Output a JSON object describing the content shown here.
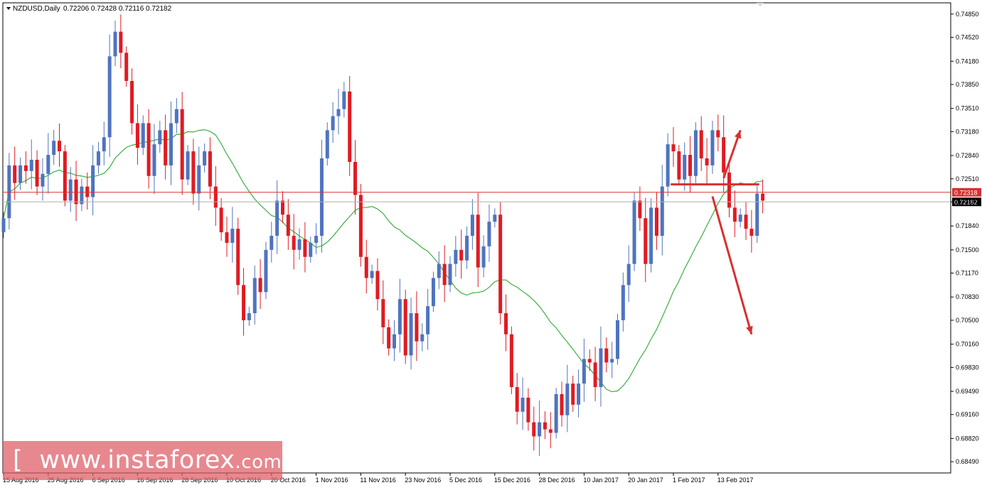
{
  "header": {
    "symbol": "NZDUSD,Daily",
    "ohlc": "0.72206 0.72428 0.72116 0.72182"
  },
  "watermark": {
    "open": "[",
    "site": "www.instaforex",
    "tld": ".com",
    "close": "]"
  },
  "colors": {
    "bull": "#4f74bf",
    "bear": "#e01b22",
    "ma": "#3cb043",
    "level": "#d83030",
    "background": "#ffffff"
  },
  "chart_data": {
    "type": "candlestick",
    "symbol": "NZDUSD",
    "timeframe": "Daily",
    "ylim": [
      0.6833,
      0.7501
    ],
    "y_ticks": [
      "0.74850",
      "0.74520",
      "0.74180",
      "0.73850",
      "0.73510",
      "0.73180",
      "0.72840",
      "0.72510",
      "0.72182",
      "0.71840",
      "0.71500",
      "0.71170",
      "0.70830",
      "0.70500",
      "0.70160",
      "0.69830",
      "0.69490",
      "0.69160",
      "0.68820",
      "0.68490"
    ],
    "x_labels": [
      {
        "text": "15 Aug 2016",
        "index": 0
      },
      {
        "text": "25 Aug 2016",
        "index": 8
      },
      {
        "text": "6 Sep 2016",
        "index": 16
      },
      {
        "text": "16 Sep 2016",
        "index": 24
      },
      {
        "text": "28 Sep 2016",
        "index": 32
      },
      {
        "text": "10 Oct 2016",
        "index": 40
      },
      {
        "text": "20 Oct 2016",
        "index": 48
      },
      {
        "text": "1 Nov 2016",
        "index": 56
      },
      {
        "text": "11 Nov 2016",
        "index": 64
      },
      {
        "text": "23 Nov 2016",
        "index": 72
      },
      {
        "text": "5 Dec 2016",
        "index": 80
      },
      {
        "text": "15 Dec 2016",
        "index": 88
      },
      {
        "text": "28 Dec 2016",
        "index": 96
      },
      {
        "text": "10 Jan 2017",
        "index": 104
      },
      {
        "text": "20 Jan 2017",
        "index": 112
      },
      {
        "text": "1 Feb 2017",
        "index": 120
      },
      {
        "text": "13 Feb 2017",
        "index": 128
      }
    ],
    "close_series": [
      0.7195,
      0.727,
      0.7245,
      0.727,
      0.7262,
      0.7278,
      0.724,
      0.7258,
      0.7285,
      0.7305,
      0.729,
      0.722,
      0.725,
      0.7215,
      0.724,
      0.7225,
      0.727,
      0.729,
      0.731,
      0.7425,
      0.746,
      0.743,
      0.739,
      0.733,
      0.7295,
      0.733,
      0.7255,
      0.73,
      0.732,
      0.727,
      0.733,
      0.735,
      0.725,
      0.729,
      0.723,
      0.727,
      0.729,
      0.724,
      0.721,
      0.7175,
      0.716,
      0.718,
      0.71,
      0.705,
      0.706,
      0.711,
      0.709,
      0.715,
      0.717,
      0.722,
      0.72,
      0.717,
      0.715,
      0.7165,
      0.714,
      0.716,
      0.717,
      0.728,
      0.732,
      0.734,
      0.735,
      0.7375,
      0.7275,
      0.7228,
      0.714,
      0.711,
      0.712,
      0.708,
      0.704,
      0.701,
      0.703,
      0.708,
      0.7,
      0.706,
      0.702,
      0.703,
      0.707,
      0.711,
      0.713,
      0.71,
      0.713,
      0.715,
      0.7135,
      0.717,
      0.72,
      0.7125,
      0.7155,
      0.719,
      0.72,
      0.706,
      0.703,
      0.6955,
      0.692,
      0.694,
      0.6905,
      0.6885,
      0.6905,
      0.6895,
      0.689,
      0.6945,
      0.6915,
      0.696,
      0.693,
      0.696,
      0.6995,
      0.699,
      0.6955,
      0.701,
      0.699,
      0.6995,
      0.705,
      0.71,
      0.713,
      0.722,
      0.7195,
      0.713,
      0.721,
      0.717,
      0.724,
      0.73,
      0.729,
      0.725,
      0.7285,
      0.7255,
      0.732,
      0.728,
      0.727,
      0.732,
      0.731,
      0.726,
      0.721,
      0.719,
      0.72,
      0.718,
      0.717,
      0.723,
      0.722
    ],
    "moving_average": {
      "type": "MA",
      "color": "#3cb043",
      "smoothing": "≈20-day"
    },
    "horizontal_lines": [
      {
        "value": 0.72318,
        "label": "0.72318",
        "color": "#d83030"
      },
      {
        "value": 0.72182,
        "label": "0.72182",
        "color": "#b0b0b0"
      }
    ],
    "annotations": [
      {
        "type": "resistance-segment",
        "value": 0.7243,
        "from_index": 119,
        "to_index": 135
      },
      {
        "type": "arrow-up",
        "from": {
          "index": 129,
          "value": 0.7252
        },
        "to": {
          "index": 132,
          "value": 0.732
        }
      },
      {
        "type": "arrow-down",
        "from": {
          "index": 127,
          "value": 0.7226
        },
        "to": {
          "index": 134,
          "value": 0.703
        }
      }
    ]
  }
}
